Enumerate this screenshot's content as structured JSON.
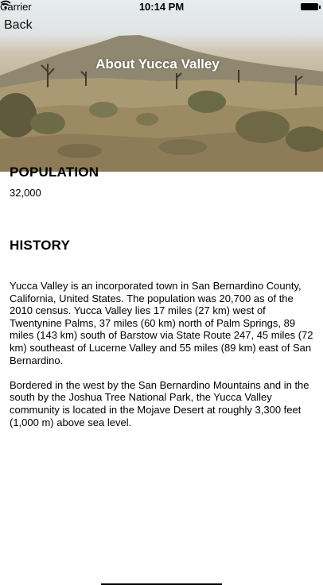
{
  "status_bar": {
    "carrier": "Carrier",
    "time": "10:14 PM"
  },
  "nav": {
    "back_label": "Back",
    "title": "About Yucca Valley"
  },
  "population": {
    "label": "POPULATION",
    "value": "32,000"
  },
  "history": {
    "label": "HISTORY",
    "paragraphs": [
      "Yucca Valley is an incorporated town in San Bernardino County, California, United States. The population was 20,700 as of the 2010 census. Yucca Valley lies 17 miles (27 km) west of Twentynine Palms, 37 miles (60 km) north of Palm Springs, 89 miles (143 km) south of Barstow via State Route 247, 45 miles (72 km) southeast of Lucerne Valley and 55 miles (89 km) east of San Bernardino.",
      "Bordered in the west by the San Bernardino Mountains and in the south by the Joshua Tree National Park, the Yucca Valley community is located in the Mojave Desert at roughly 3,300 feet (1,000 m) above sea level."
    ]
  }
}
